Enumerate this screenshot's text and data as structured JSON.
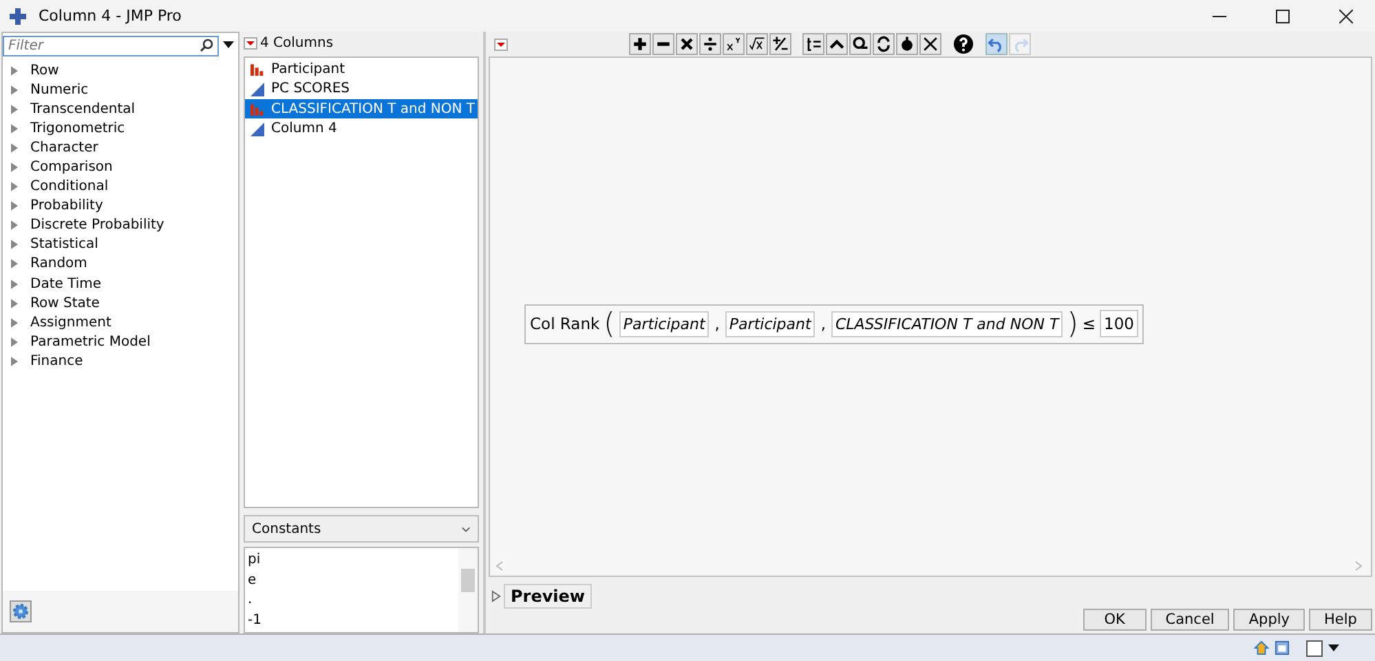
{
  "window": {
    "title": "Column 4 - JMP Pro"
  },
  "filter": {
    "placeholder": "Filter"
  },
  "functions": [
    {
      "label": "Row"
    },
    {
      "label": "Numeric"
    },
    {
      "label": "Transcendental"
    },
    {
      "label": "Trigonometric"
    },
    {
      "label": "Character"
    },
    {
      "label": "Comparison"
    },
    {
      "label": "Conditional"
    },
    {
      "label": "Probability"
    },
    {
      "label": "Discrete Probability"
    },
    {
      "label": "Statistical"
    },
    {
      "label": "Random"
    },
    {
      "label": "Date Time"
    },
    {
      "label": "Row State"
    },
    {
      "label": "Assignment"
    },
    {
      "label": "Parametric Model"
    },
    {
      "label": "Finance"
    }
  ],
  "columns": {
    "header": "4 Columns",
    "items": [
      {
        "label": "Participant",
        "kind": "nominal",
        "selected": false
      },
      {
        "label": "PC SCORES",
        "kind": "continuous",
        "selected": false
      },
      {
        "label": "CLASSIFICATION T and NON T",
        "kind": "nominal",
        "selected": true
      },
      {
        "label": "Column 4",
        "kind": "continuous",
        "selected": false
      }
    ]
  },
  "constants": {
    "dropdown": "Constants",
    "items": [
      "pi",
      "e",
      ".",
      "-1"
    ]
  },
  "formula": {
    "function": "Col Rank",
    "open": "(",
    "close": ")",
    "separators": [
      ",",
      ","
    ],
    "args": [
      "Participant",
      "Participant",
      "CLASSIFICATION T and NON T"
    ],
    "operator": "≤",
    "value": "100"
  },
  "preview": {
    "label": "Preview",
    "expanded": false
  },
  "buttons": [
    "OK",
    "Cancel",
    "Apply",
    "Help"
  ]
}
